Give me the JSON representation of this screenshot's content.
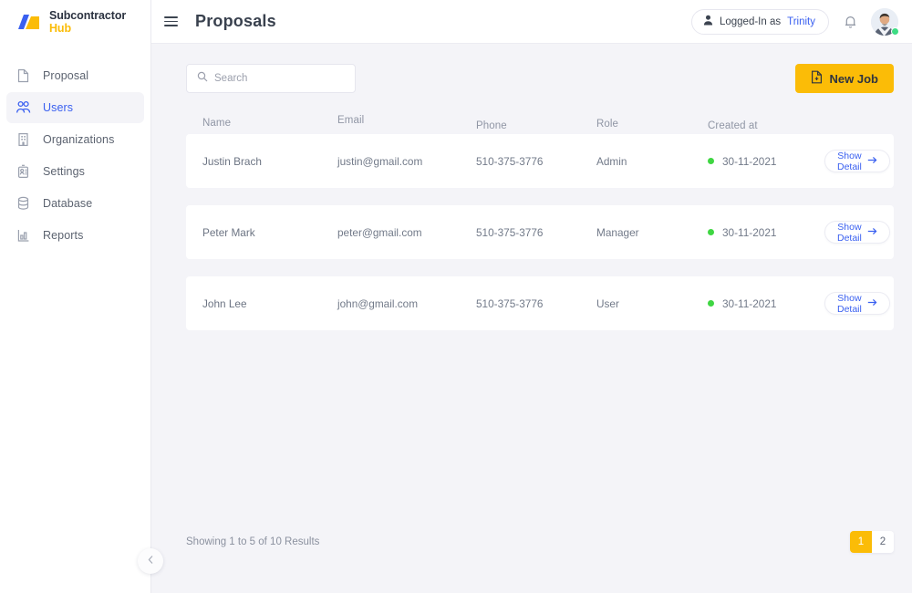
{
  "brand": {
    "name_main": "Subcontractor",
    "name_accent": "Hub",
    "logo_icon": "logo-mark-icon"
  },
  "sidebar": {
    "items": [
      {
        "label": "Proposal",
        "icon": "document-icon",
        "active": false
      },
      {
        "label": "Users",
        "icon": "users-icon",
        "active": true
      },
      {
        "label": "Organizations",
        "icon": "building-icon",
        "active": false
      },
      {
        "label": "Settings",
        "icon": "id-badge-icon",
        "active": false
      },
      {
        "label": "Database",
        "icon": "database-icon",
        "active": false
      },
      {
        "label": "Reports",
        "icon": "bar-chart-icon",
        "active": false
      }
    ],
    "collapse_icon": "chevron-left-icon"
  },
  "header": {
    "menu_icon": "hamburger-icon",
    "title": "Proposals",
    "login_prefix": "Logged-In as",
    "login_user": "Trinity",
    "person_icon": "person-icon",
    "bell_icon": "bell-icon",
    "avatar_icon": "avatar",
    "status": "online"
  },
  "toolbar": {
    "search_placeholder": "Search",
    "search_value": "",
    "search_icon": "search-icon",
    "new_job_label": "New Job",
    "new_job_icon": "file-plus-icon"
  },
  "table": {
    "columns": [
      "Name",
      "Email",
      "Phone",
      "Role",
      "Created at"
    ],
    "action_label": "Show Detail",
    "action_icon": "arrow-right-icon",
    "rows": [
      {
        "name": "Justin Brach",
        "email": "justin@gmail.com",
        "phone": "510-375-3776",
        "role": "Admin",
        "created_at": "30-11-2021",
        "status_color": "#3fd642"
      },
      {
        "name": "Peter Mark",
        "email": "peter@gmail.com",
        "phone": "510-375-3776",
        "role": "Manager",
        "created_at": "30-11-2021",
        "status_color": "#3fd642"
      },
      {
        "name": "John Lee",
        "email": "john@gmail.com",
        "phone": "510-375-3776",
        "role": "User",
        "created_at": "30-11-2021",
        "status_color": "#3fd642"
      }
    ]
  },
  "footer": {
    "results_text": "Showing 1 to 5 of 10 Results",
    "pages": [
      {
        "label": "1",
        "active": true
      },
      {
        "label": "2",
        "active": false
      }
    ]
  },
  "colors": {
    "accent_yellow": "#fbbc07",
    "accent_blue": "#3a60f0",
    "status_green": "#3fd642",
    "content_bg": "#f4f4f8"
  }
}
